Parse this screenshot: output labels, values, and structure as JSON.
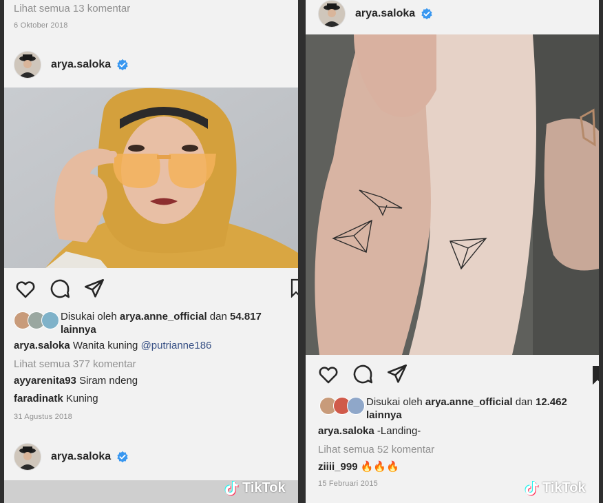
{
  "left": {
    "prev_comments_link": "Lihat semua 13 komentar",
    "prev_date": "6 Oktober 2018",
    "post": {
      "username": "arya.saloka",
      "liked_by_prefix": "Disukai oleh",
      "liked_by_user": "arya.anne_official",
      "liked_by_mid": "dan",
      "liked_by_count": "54.817",
      "liked_by_suffix": "lainnya",
      "caption_user": "arya.saloka",
      "caption_text": "Wanita kuning",
      "caption_mention": "@putrianne186",
      "view_comments": "Lihat semua 377 komentar",
      "comments": [
        {
          "user": "ayyarenita93",
          "text": "Siram ndeng"
        },
        {
          "user": "faradinatk",
          "text": "Kuning"
        }
      ],
      "date": "31 Agustus 2018"
    },
    "next_post": {
      "username": "arya.saloka"
    },
    "watermark": "TikTok"
  },
  "right": {
    "post": {
      "username": "arya.saloka",
      "liked_by_prefix": "Disukai oleh",
      "liked_by_user": "arya.anne_official",
      "liked_by_mid": "dan",
      "liked_by_count": "12.462",
      "liked_by_suffix": "lainnya",
      "caption_user": "arya.saloka",
      "caption_text": "-Landing-",
      "view_comments": "Lihat semua 52 komentar",
      "comments": [
        {
          "user": "ziiii_999",
          "text": "🔥🔥🔥"
        }
      ],
      "date": "15 Februari 2015"
    },
    "watermark": "TikTok"
  },
  "colors": {
    "verified_blue": "#3897f0",
    "mustard_hijab": "#d9a642",
    "text_dark": "#262626",
    "text_muted": "#8f8f8f",
    "mention_link": "#385185"
  },
  "icons": [
    "heart-icon",
    "comment-icon",
    "share-icon",
    "bookmark-icon",
    "verified-badge-icon",
    "tiktok-logo-icon"
  ]
}
